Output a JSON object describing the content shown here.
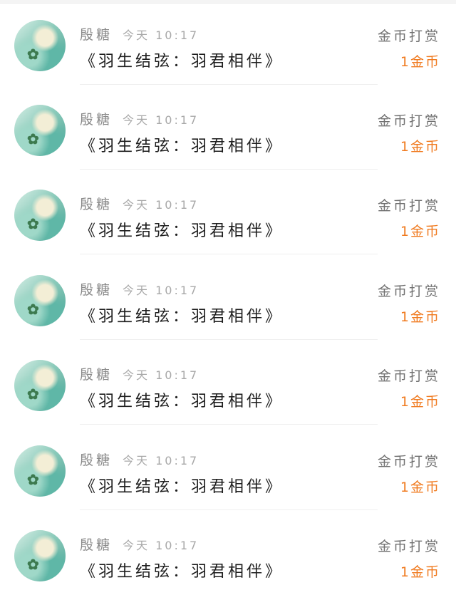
{
  "items": [
    {
      "name": "殷糖",
      "time": "今天 10:17",
      "title": "《羽生结弦：羽君相伴》",
      "reward_label": "金币打赏",
      "reward_amount": "1金币"
    },
    {
      "name": "殷糖",
      "time": "今天 10:17",
      "title": "《羽生结弦：羽君相伴》",
      "reward_label": "金币打赏",
      "reward_amount": "1金币"
    },
    {
      "name": "殷糖",
      "time": "今天 10:17",
      "title": "《羽生结弦：羽君相伴》",
      "reward_label": "金币打赏",
      "reward_amount": "1金币"
    },
    {
      "name": "殷糖",
      "time": "今天 10:17",
      "title": "《羽生结弦：羽君相伴》",
      "reward_label": "金币打赏",
      "reward_amount": "1金币"
    },
    {
      "name": "殷糖",
      "time": "今天 10:17",
      "title": "《羽生结弦：羽君相伴》",
      "reward_label": "金币打赏",
      "reward_amount": "1金币"
    },
    {
      "name": "殷糖",
      "time": "今天 10:17",
      "title": "《羽生结弦：羽君相伴》",
      "reward_label": "金币打赏",
      "reward_amount": "1金币"
    },
    {
      "name": "殷糖",
      "time": "今天 10:17",
      "title": "《羽生结弦：羽君相伴》",
      "reward_label": "金币打赏",
      "reward_amount": "1金币"
    }
  ],
  "colors": {
    "reward_amount": "#f07a1f",
    "name": "#8a8a8a",
    "title": "#1e1e1e"
  },
  "icons": {
    "avatar": "user-avatar-image"
  }
}
